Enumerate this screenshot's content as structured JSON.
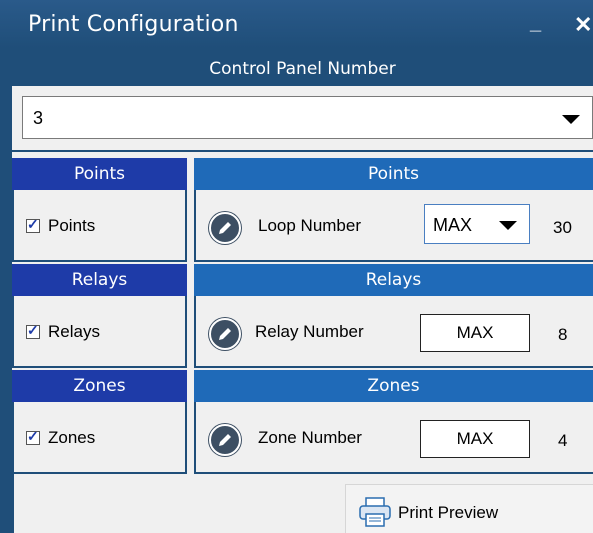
{
  "window": {
    "title": "Print Configuration",
    "minimize_glyph": "_",
    "close_glyph": "✕"
  },
  "control_panel": {
    "header": "Control Panel Number",
    "selected_value": "3"
  },
  "sections": [
    {
      "left_header": "Points",
      "checkbox_label": "Points",
      "checked": true,
      "right_header": "Points",
      "field_label": "Loop Number",
      "value": "MAX",
      "value_is_dropdown": true,
      "count": "30"
    },
    {
      "left_header": "Relays",
      "checkbox_label": "Relays",
      "checked": true,
      "right_header": "Relays",
      "field_label": "Relay Number",
      "value": "MAX",
      "value_is_dropdown": false,
      "count": "8"
    },
    {
      "left_header": "Zones",
      "checkbox_label": "Zones",
      "checked": true,
      "right_header": "Zones",
      "field_label": "Zone Number",
      "value": "MAX",
      "value_is_dropdown": false,
      "count": "4"
    }
  ],
  "print_preview": {
    "label": "Print Preview",
    "icon": "printer-icon"
  },
  "colors": {
    "title_bar": "#1f4e79",
    "left_header": "#1e3ba8",
    "right_header": "#1f6ab8",
    "body": "#f0f0f0"
  }
}
